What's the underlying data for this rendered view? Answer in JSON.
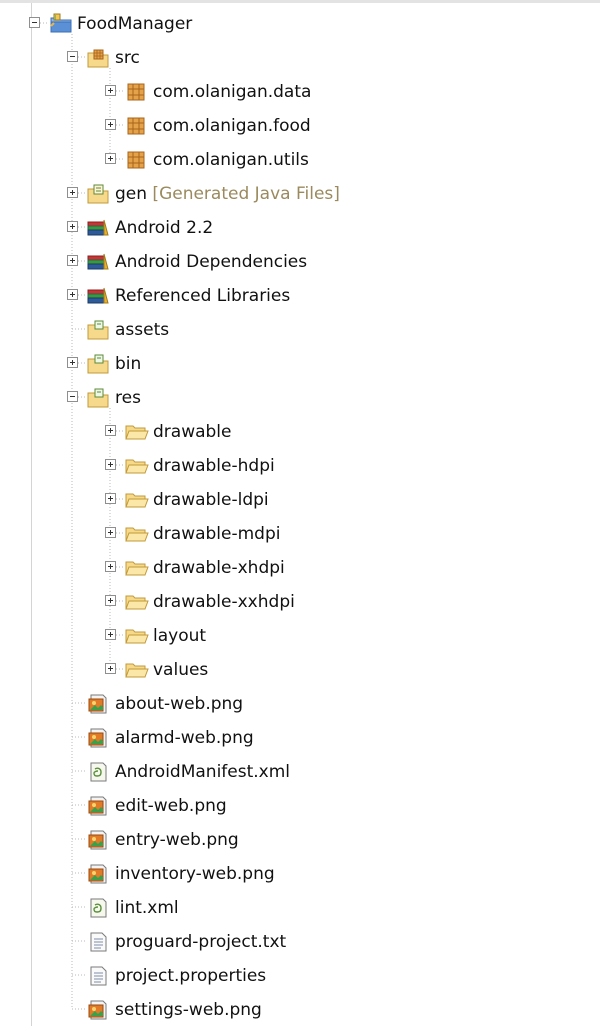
{
  "colors": {
    "guide": "#b8b8b8",
    "decoration": "#9a8a5e",
    "folder_fill": "#f6d98a",
    "folder_stroke": "#c19a3a",
    "package_fill": "#e4a24a",
    "library_blue": "#2d5b9a",
    "image_icon": "#e27b27"
  },
  "tree": {
    "nodes": [
      {
        "label": "FoodManager",
        "icon": "project-icon",
        "toggle": "expanded",
        "level": 0
      },
      {
        "label": "src",
        "icon": "source-folder-icon",
        "toggle": "expanded",
        "level": 1
      },
      {
        "label": "com.olanigan.data",
        "icon": "package-icon",
        "toggle": "collapsed",
        "level": 2
      },
      {
        "label": "com.olanigan.food",
        "icon": "package-icon",
        "toggle": "collapsed",
        "level": 2
      },
      {
        "label": "com.olanigan.utils",
        "icon": "package-icon",
        "toggle": "collapsed",
        "level": 2
      },
      {
        "label": "gen",
        "decoration": "[Generated Java Files]",
        "icon": "generated-folder-icon",
        "toggle": "collapsed",
        "level": 1
      },
      {
        "label": "Android 2.2",
        "icon": "library-icon",
        "toggle": "collapsed",
        "level": 1
      },
      {
        "label": "Android Dependencies",
        "icon": "library-icon",
        "toggle": "collapsed",
        "level": 1
      },
      {
        "label": "Referenced Libraries",
        "icon": "library-icon",
        "toggle": "collapsed",
        "level": 1
      },
      {
        "label": "assets",
        "icon": "folder-icon",
        "toggle": "none",
        "level": 1
      },
      {
        "label": "bin",
        "icon": "folder-icon",
        "toggle": "collapsed",
        "level": 1
      },
      {
        "label": "res",
        "icon": "folder-icon",
        "toggle": "expanded",
        "level": 1
      },
      {
        "label": "drawable",
        "icon": "open-folder-icon",
        "toggle": "collapsed",
        "level": 2
      },
      {
        "label": "drawable-hdpi",
        "icon": "open-folder-icon",
        "toggle": "collapsed",
        "level": 2
      },
      {
        "label": "drawable-ldpi",
        "icon": "open-folder-icon",
        "toggle": "collapsed",
        "level": 2
      },
      {
        "label": "drawable-mdpi",
        "icon": "open-folder-icon",
        "toggle": "collapsed",
        "level": 2
      },
      {
        "label": "drawable-xhdpi",
        "icon": "open-folder-icon",
        "toggle": "collapsed",
        "level": 2
      },
      {
        "label": "drawable-xxhdpi",
        "icon": "open-folder-icon",
        "toggle": "collapsed",
        "level": 2
      },
      {
        "label": "layout",
        "icon": "open-folder-icon",
        "toggle": "collapsed",
        "level": 2
      },
      {
        "label": "values",
        "icon": "open-folder-icon",
        "toggle": "collapsed",
        "level": 2
      },
      {
        "label": "about-web.png",
        "icon": "image-file-icon",
        "toggle": "none",
        "level": 1
      },
      {
        "label": "alarmd-web.png",
        "icon": "image-file-icon",
        "toggle": "none",
        "level": 1
      },
      {
        "label": "AndroidManifest.xml",
        "icon": "xml-file-icon",
        "toggle": "none",
        "level": 1
      },
      {
        "label": "edit-web.png",
        "icon": "image-file-icon",
        "toggle": "none",
        "level": 1
      },
      {
        "label": "entry-web.png",
        "icon": "image-file-icon",
        "toggle": "none",
        "level": 1
      },
      {
        "label": "inventory-web.png",
        "icon": "image-file-icon",
        "toggle": "none",
        "level": 1
      },
      {
        "label": "lint.xml",
        "icon": "xml-file-icon",
        "toggle": "none",
        "level": 1
      },
      {
        "label": "proguard-project.txt",
        "icon": "text-file-icon",
        "toggle": "none",
        "level": 1
      },
      {
        "label": "project.properties",
        "icon": "text-file-icon",
        "toggle": "none",
        "level": 1
      },
      {
        "label": "settings-web.png",
        "icon": "image-file-icon",
        "toggle": "none",
        "level": 1
      }
    ]
  }
}
